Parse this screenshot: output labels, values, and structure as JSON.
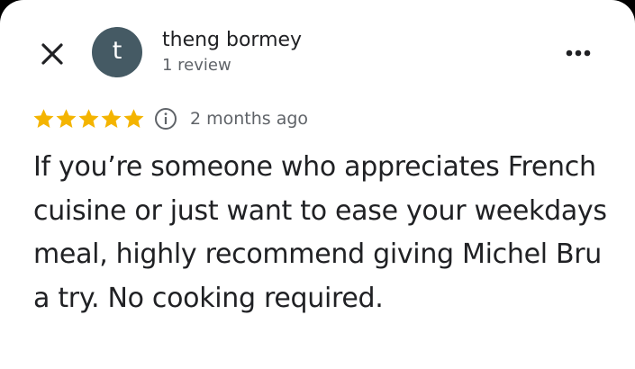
{
  "reviewer": {
    "avatar_initial": "t",
    "name": "theng bormey",
    "review_count": "1 review"
  },
  "rating": {
    "stars": 5,
    "max_stars": 5,
    "date": "2 months ago"
  },
  "review": {
    "text": "If you’re someone who appreciates French cuisine or just want to ease your weekdays meal, highly recommend giving Michel Bru a try. No cooking required."
  },
  "colors": {
    "star": "#f4b400",
    "avatar_bg": "#455a64",
    "primary_text": "#202124",
    "secondary_text": "#5f6368"
  },
  "icons": {
    "close": "close-icon",
    "more": "more-horizontal-icon",
    "star": "star-icon",
    "info": "info-icon"
  }
}
